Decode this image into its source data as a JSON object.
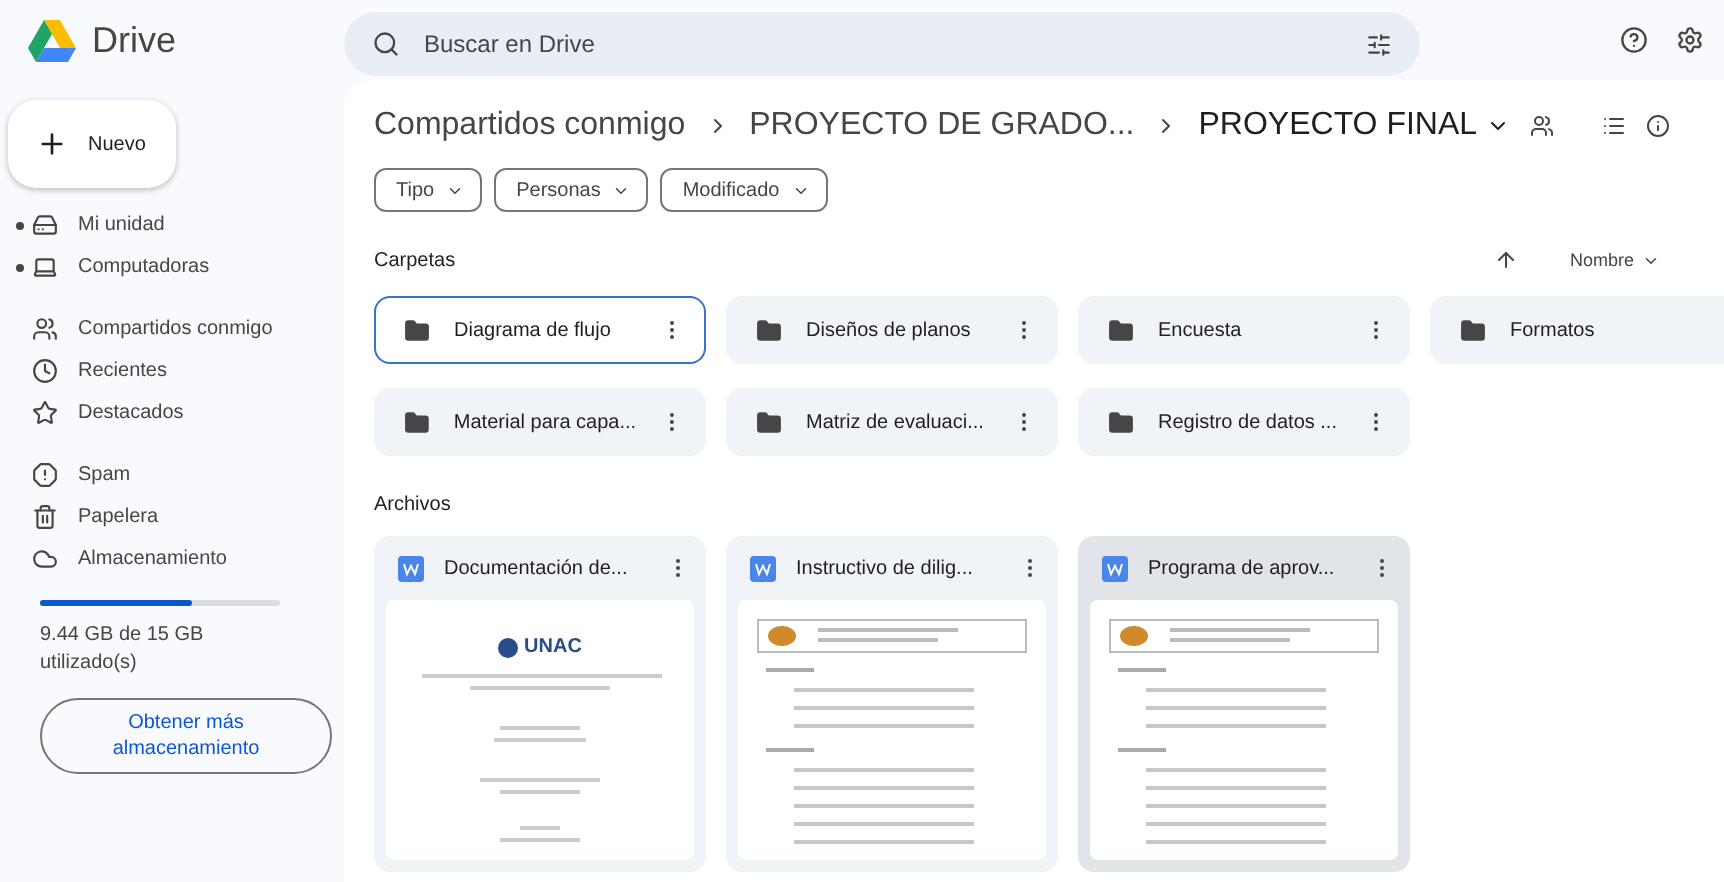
{
  "app": {
    "name": "Drive"
  },
  "search": {
    "placeholder": "Buscar en Drive"
  },
  "sidebar": {
    "new_button": "Nuevo",
    "items": [
      {
        "label": "Mi unidad",
        "expandable": true
      },
      {
        "label": "Computadoras",
        "expandable": true
      },
      {
        "label": "Compartidos conmigo",
        "expandable": false
      },
      {
        "label": "Recientes",
        "expandable": false
      },
      {
        "label": "Destacados",
        "expandable": false
      },
      {
        "label": "Spam",
        "expandable": false
      },
      {
        "label": "Papelera",
        "expandable": false
      },
      {
        "label": "Almacenamiento",
        "expandable": false
      }
    ],
    "storage": {
      "level": 0.63,
      "text": "9.44 GB de 15 GB utilizado(s)",
      "button": "Obtener más almacenamiento"
    }
  },
  "breadcrumb": [
    "Compartidos conmigo",
    "PROYECTO DE GRADO...",
    "PROYECTO FINAL"
  ],
  "filters": [
    "Tipo",
    "Personas",
    "Modificado"
  ],
  "sort": {
    "label": "Nombre"
  },
  "folders_section": {
    "title": "Carpetas",
    "folders": [
      {
        "name": "Diagrama de flujo",
        "selected": true
      },
      {
        "name": "Diseños de planos",
        "selected": false
      },
      {
        "name": "Encuesta",
        "selected": false
      },
      {
        "name": "Formatos",
        "selected": false
      },
      {
        "name": "Material para capa...",
        "selected": false
      },
      {
        "name": "Matriz de evaluaci...",
        "selected": false
      },
      {
        "name": "Registro de datos ...",
        "selected": false
      }
    ]
  },
  "files_section": {
    "title": "Archivos",
    "files": [
      {
        "name": "Documentación de...",
        "selected": false,
        "thumbnail": {
          "kind": "cover",
          "logo": "UNAC"
        }
      },
      {
        "name": "Instructivo de dilig...",
        "selected": false,
        "thumbnail": {
          "kind": "form"
        }
      },
      {
        "name": "Programa de aprov...",
        "selected": true,
        "thumbnail": {
          "kind": "form"
        }
      }
    ]
  }
}
